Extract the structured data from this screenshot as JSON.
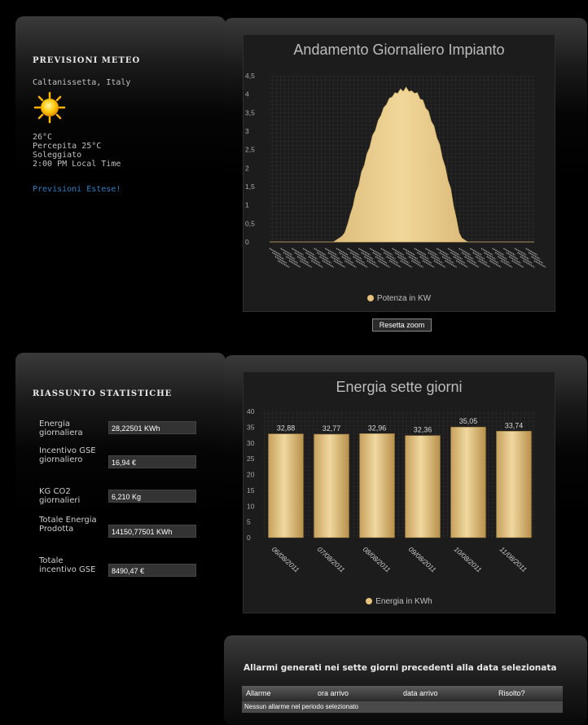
{
  "colors": {
    "bar_fill": "#e6c27a",
    "link": "#2f7fc4",
    "chart_bg": "#1c1c1c"
  },
  "meteo": {
    "title": "PREVISIONI METEO",
    "location": "Caltanissetta, Italy",
    "icon": "sun-icon",
    "temp": "26°C",
    "perceived": "Percepita 25°C",
    "condition": "Soleggiato",
    "time": "2:00 PM Local Time",
    "link": "Previsioni Estese!"
  },
  "stats": {
    "title": "RIASSUNTO STATISTICHE",
    "rows": [
      {
        "label": "Energia giornaliera",
        "value": "28,22501 KWh"
      },
      {
        "label": "Incentivo GSE giornaliero",
        "value": "16,94 €"
      },
      {
        "label": "KG CO2 giornalieri",
        "value": "6,210 Kg"
      },
      {
        "label": "Totale Energia Prodotta",
        "value": "14150,77501 KWh"
      },
      {
        "label": "Totale incentivo GSE",
        "value": "8490,47 €"
      }
    ]
  },
  "reset_zoom": "Resetta zoom",
  "alarms": {
    "title": "Allarmi generati nei sette giorni precedenti alla data selezionata",
    "columns": [
      "Allarme",
      "ora arrivo",
      "data arrivo",
      "Risolto?"
    ],
    "empty_message": "Nessun allarme nel periodo selezionato"
  },
  "chart_data": [
    {
      "type": "area",
      "title": "Andamento Giornaliero Impianto",
      "legend": "Potenza in KW",
      "legend_position": "bottom",
      "grid": true,
      "ylim": [
        0,
        4.5
      ],
      "yticks": [
        "0",
        "0,5",
        "1",
        "1,5",
        "2",
        "2,5",
        "3",
        "3,5",
        "4",
        "4,5"
      ],
      "x_count": 96,
      "series": [
        {
          "name": "Potenza in KW",
          "values": [
            0,
            0,
            0,
            0,
            0,
            0,
            0,
            0,
            0,
            0,
            0,
            0,
            0,
            0,
            0,
            0,
            0,
            0,
            0,
            0,
            0,
            0,
            0,
            0,
            0.05,
            0.1,
            0.15,
            0.25,
            0.5,
            0.7,
            1.0,
            1.3,
            1.55,
            1.85,
            2.1,
            2.35,
            2.6,
            2.85,
            3.05,
            3.25,
            3.45,
            3.6,
            3.75,
            3.85,
            3.95,
            4.0,
            4.05,
            4.1,
            4.1,
            4.15,
            4.1,
            4.05,
            4.05,
            4.0,
            3.9,
            3.8,
            3.65,
            3.5,
            3.3,
            3.1,
            2.85,
            2.6,
            2.3,
            2.0,
            1.7,
            1.4,
            1.0,
            0.6,
            0.25,
            0.1,
            0.05,
            0,
            0,
            0,
            0,
            0,
            0,
            0,
            0,
            0,
            0,
            0,
            0,
            0,
            0,
            0,
            0,
            0,
            0,
            0,
            0,
            0,
            0,
            0,
            0,
            0
          ]
        }
      ]
    },
    {
      "type": "bar",
      "title": "Energia sette giorni",
      "legend": "Energia in KWh",
      "legend_position": "bottom",
      "grid": true,
      "ylim": [
        0,
        40
      ],
      "yticks": [
        "0",
        "5",
        "10",
        "15",
        "20",
        "25",
        "30",
        "35",
        "40"
      ],
      "categories": [
        "06/08/2011",
        "07/08/2011",
        "08/08/2011",
        "09/08/2011",
        "10/08/2011",
        "11/08/2011"
      ],
      "series": [
        {
          "name": "Energia in KWh",
          "values": [
            32.88,
            32.77,
            32.96,
            32.36,
            35.05,
            33.74
          ],
          "labels": [
            "32,88",
            "32,77",
            "32,96",
            "32,36",
            "35,05",
            "33,74"
          ]
        }
      ]
    }
  ]
}
